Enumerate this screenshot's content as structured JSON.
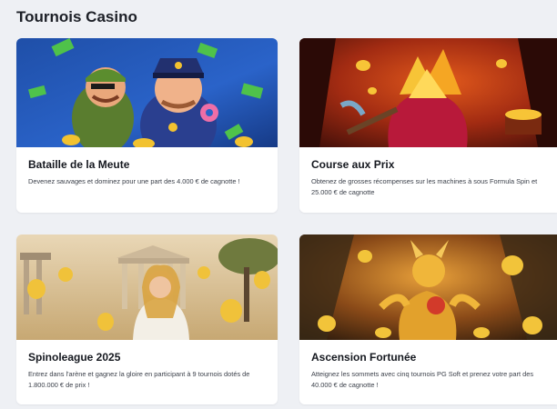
{
  "page": {
    "title": "Tournois Casino"
  },
  "cards": [
    {
      "title": "Bataille de la Meute",
      "desc": "Devenez sauvages et dominez pour une part des 4.000 € de cagnotte !",
      "art": "cartoon-bandit-and-police-art"
    },
    {
      "title": "Course aux Prix",
      "desc": "Obtenez de grosses récompenses sur les machines à sous Formula Spin et 25.000 € de cagnotte",
      "art": "gold-mine-treasure-art"
    },
    {
      "title": "Spinoleague 2025",
      "desc": "Entrez dans l'arène et gagnez la gloire en participant à 9 tournois dotés de 1.800.000 € de prix !",
      "art": "greek-goddess-temple-art"
    },
    {
      "title": "Ascension Fortunée",
      "desc": "Atteignez les sommets avec cinq tournois PG Soft et prenez votre part des 40.000 € de cagnotte !",
      "art": "golden-dragon-art"
    }
  ],
  "colors": {
    "background": "#eef0f4",
    "card": "#ffffff",
    "text": "#1c1f26"
  }
}
